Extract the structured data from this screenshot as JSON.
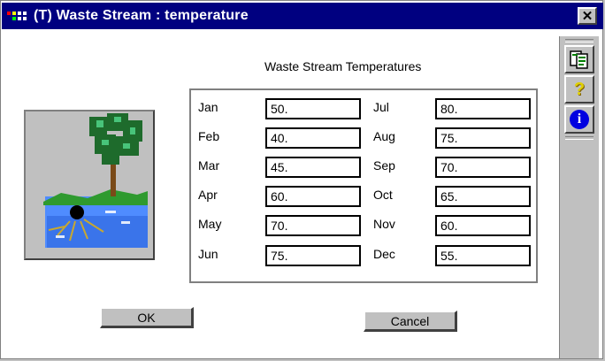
{
  "window": {
    "title": "(T) Waste Stream : temperature",
    "close_symbol": "✕"
  },
  "panel": {
    "heading": "Waste Stream Temperatures"
  },
  "months_left": [
    {
      "label": "Jan",
      "value": "50."
    },
    {
      "label": "Feb",
      "value": "40."
    },
    {
      "label": "Mar",
      "value": "45."
    },
    {
      "label": "Apr",
      "value": "60."
    },
    {
      "label": "May",
      "value": "70."
    },
    {
      "label": "Jun",
      "value": "75."
    }
  ],
  "months_right": [
    {
      "label": "Jul",
      "value": "80."
    },
    {
      "label": "Aug",
      "value": "75."
    },
    {
      "label": "Sep",
      "value": "70."
    },
    {
      "label": "Oct",
      "value": "65."
    },
    {
      "label": "Nov",
      "value": "60."
    },
    {
      "label": "Dec",
      "value": "55."
    }
  ],
  "buttons": {
    "ok": "OK",
    "cancel": "Cancel"
  },
  "toolbar": {
    "items": [
      {
        "icon": "copy-icon"
      },
      {
        "icon": "help-icon",
        "glyph": "?"
      },
      {
        "icon": "info-icon",
        "glyph": "i"
      }
    ]
  },
  "colors": {
    "titlebar": "#000080",
    "face": "#c0c0c0",
    "water": "#4f8cff",
    "tree": "#2f7f3f"
  }
}
